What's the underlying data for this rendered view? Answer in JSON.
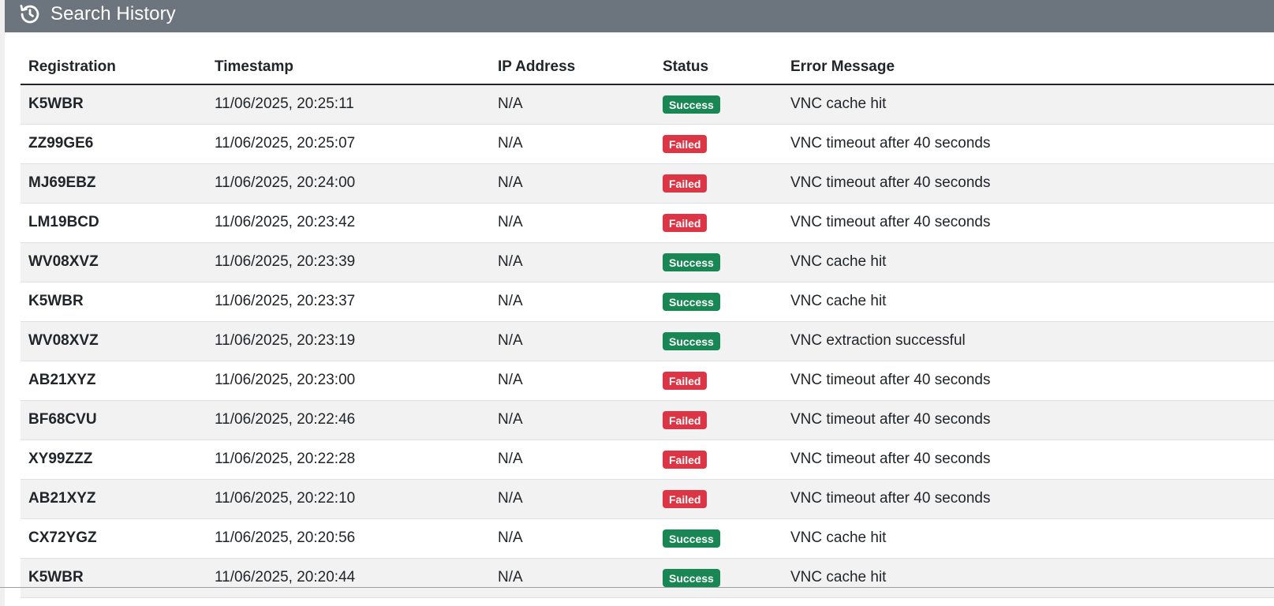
{
  "header": {
    "title": "Search History",
    "icon": "history-icon",
    "bg_color": "#6c757d"
  },
  "table": {
    "columns": [
      "Registration",
      "Timestamp",
      "IP Address",
      "Status",
      "Error Message"
    ],
    "rows": [
      {
        "registration": "K5WBR",
        "timestamp": "11/06/2025, 20:25:11",
        "ip": "N/A",
        "status": "Success",
        "message": "VNC cache hit"
      },
      {
        "registration": "ZZ99GE6",
        "timestamp": "11/06/2025, 20:25:07",
        "ip": "N/A",
        "status": "Failed",
        "message": "VNC timeout after 40 seconds"
      },
      {
        "registration": "MJ69EBZ",
        "timestamp": "11/06/2025, 20:24:00",
        "ip": "N/A",
        "status": "Failed",
        "message": "VNC timeout after 40 seconds"
      },
      {
        "registration": "LM19BCD",
        "timestamp": "11/06/2025, 20:23:42",
        "ip": "N/A",
        "status": "Failed",
        "message": "VNC timeout after 40 seconds"
      },
      {
        "registration": "WV08XVZ",
        "timestamp": "11/06/2025, 20:23:39",
        "ip": "N/A",
        "status": "Success",
        "message": "VNC cache hit"
      },
      {
        "registration": "K5WBR",
        "timestamp": "11/06/2025, 20:23:37",
        "ip": "N/A",
        "status": "Success",
        "message": "VNC cache hit"
      },
      {
        "registration": "WV08XVZ",
        "timestamp": "11/06/2025, 20:23:19",
        "ip": "N/A",
        "status": "Success",
        "message": "VNC extraction successful"
      },
      {
        "registration": "AB21XYZ",
        "timestamp": "11/06/2025, 20:23:00",
        "ip": "N/A",
        "status": "Failed",
        "message": "VNC timeout after 40 seconds"
      },
      {
        "registration": "BF68CVU",
        "timestamp": "11/06/2025, 20:22:46",
        "ip": "N/A",
        "status": "Failed",
        "message": "VNC timeout after 40 seconds"
      },
      {
        "registration": "XY99ZZZ",
        "timestamp": "11/06/2025, 20:22:28",
        "ip": "N/A",
        "status": "Failed",
        "message": "VNC timeout after 40 seconds"
      },
      {
        "registration": "AB21XYZ",
        "timestamp": "11/06/2025, 20:22:10",
        "ip": "N/A",
        "status": "Failed",
        "message": "VNC timeout after 40 seconds"
      },
      {
        "registration": "CX72YGZ",
        "timestamp": "11/06/2025, 20:20:56",
        "ip": "N/A",
        "status": "Success",
        "message": "VNC cache hit"
      },
      {
        "registration": "K5WBR",
        "timestamp": "11/06/2025, 20:20:44",
        "ip": "N/A",
        "status": "Success",
        "message": "VNC cache hit"
      }
    ]
  },
  "colors": {
    "success": "#198754",
    "failed": "#dc3545",
    "stripe": "#f2f2f2"
  }
}
